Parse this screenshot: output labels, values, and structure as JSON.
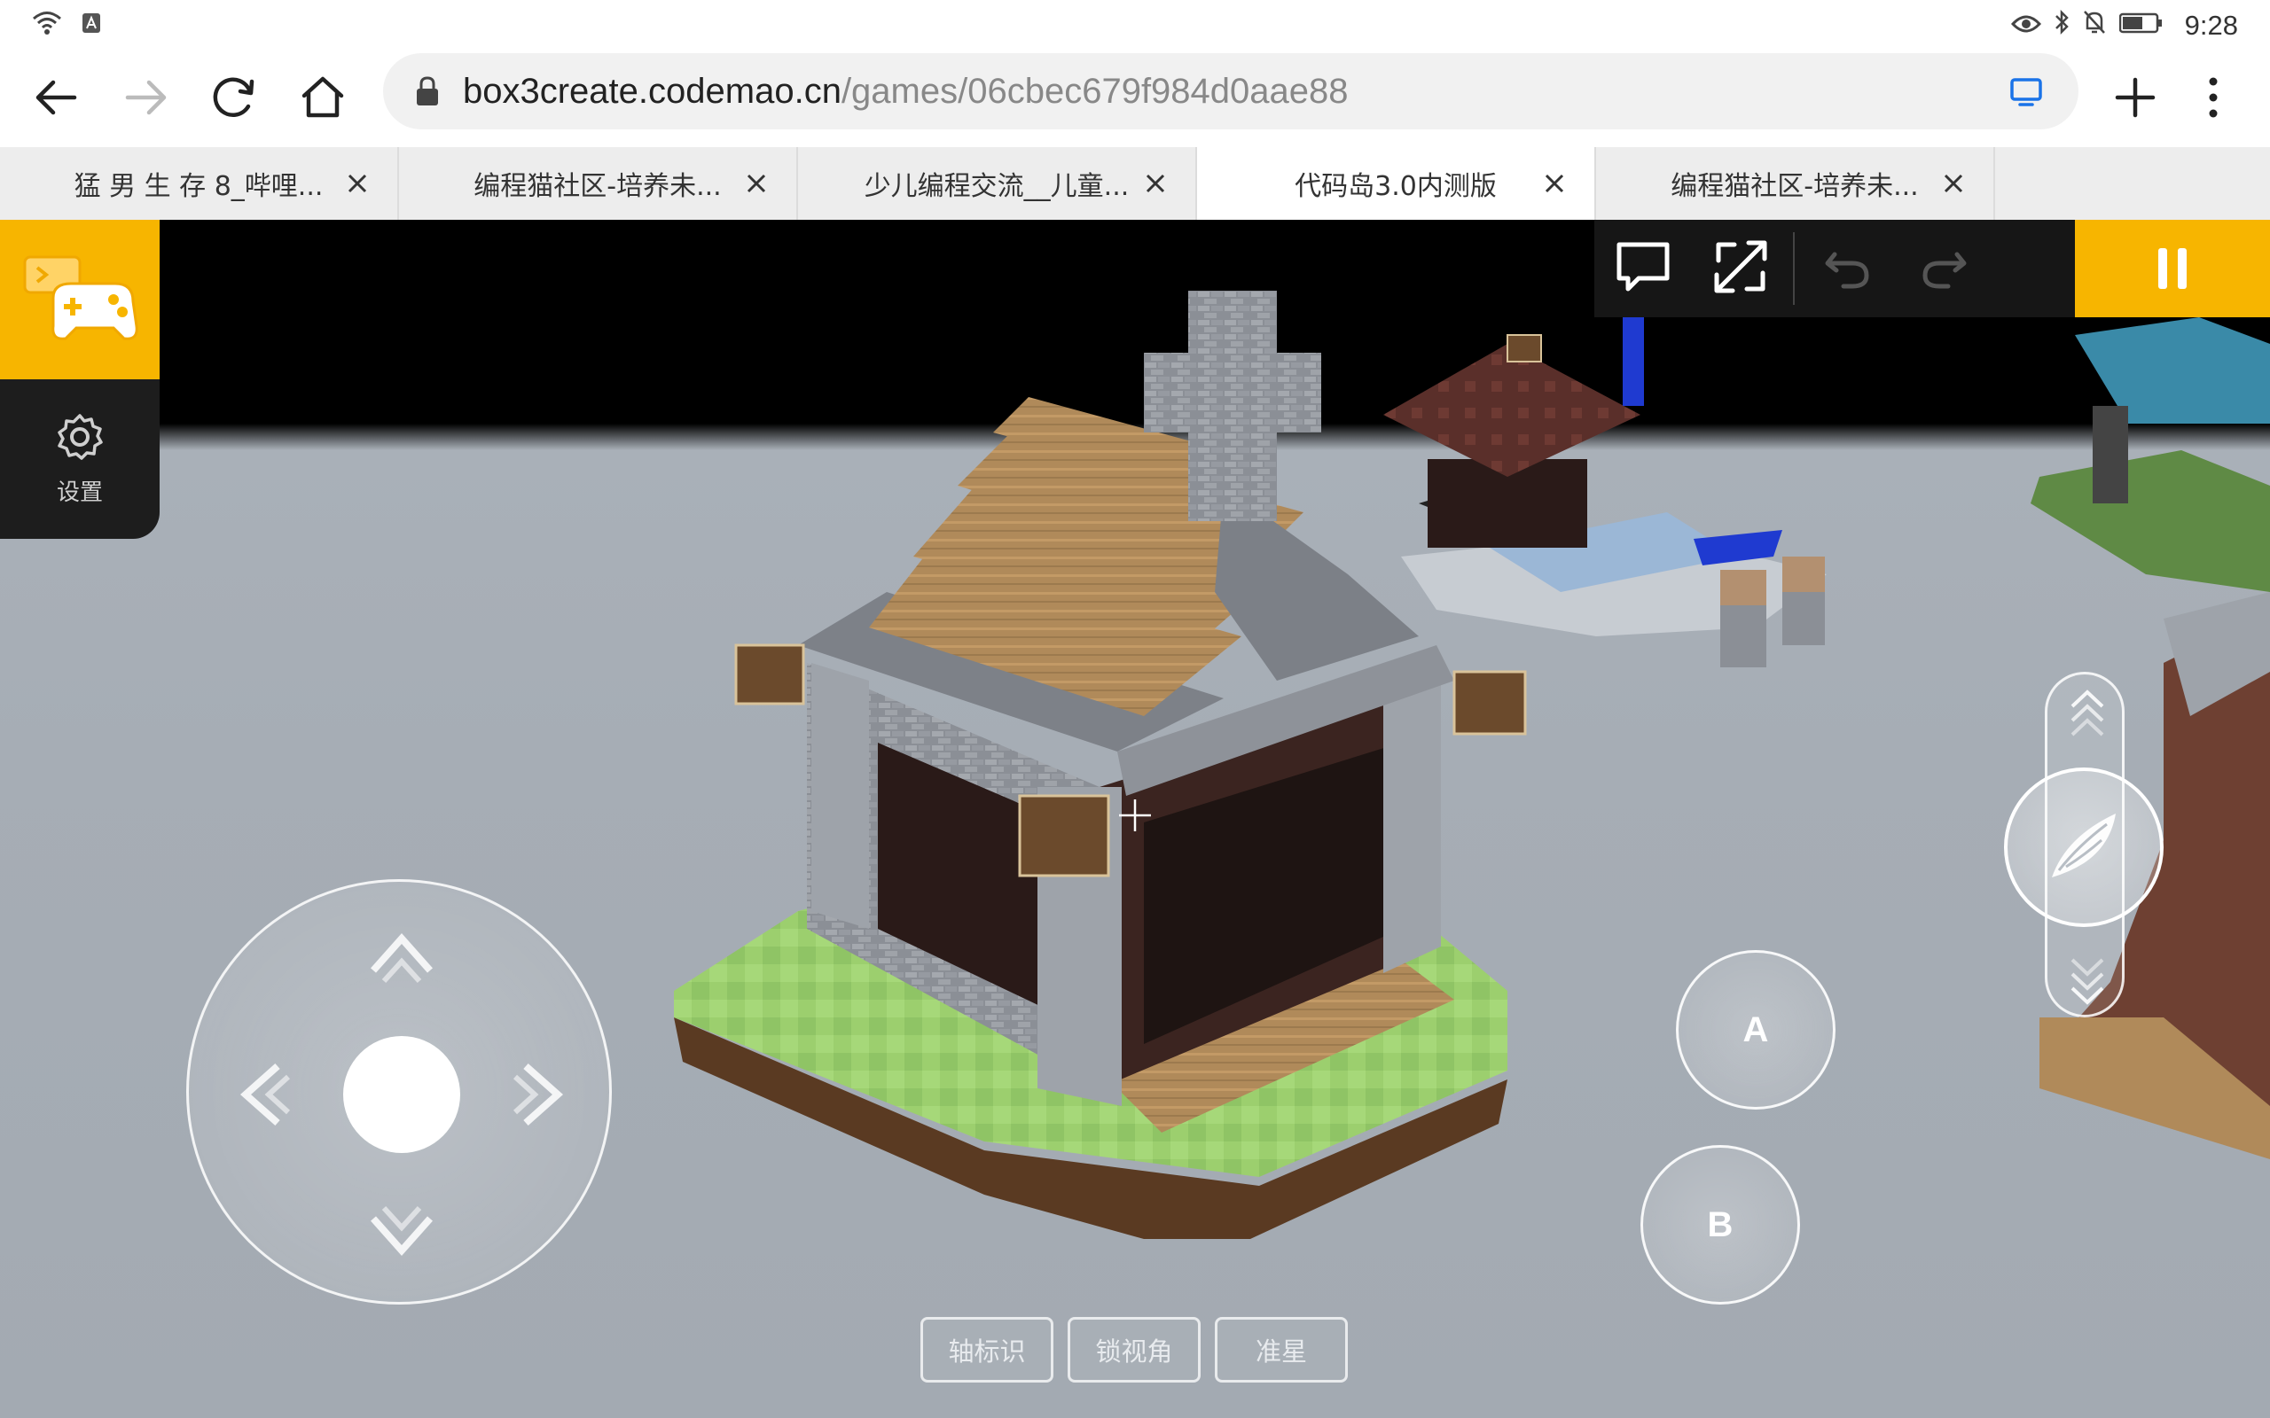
{
  "status_bar": {
    "time": "9:28"
  },
  "address_bar": {
    "url_host": "box3create.codemao.cn",
    "url_path": "/games/06cbec679f984d0aae88"
  },
  "tabs": [
    {
      "label": "猛 男 生 存 8_哔哩..."
    },
    {
      "label": "编程猫社区-培养未..."
    },
    {
      "label": "少儿编程交流__儿童..."
    },
    {
      "label": "代码岛3.0内测版",
      "active": true
    },
    {
      "label": "编程猫社区-培养未..."
    }
  ],
  "game": {
    "side_panel": {
      "settings_label": "设置"
    },
    "buttons": {
      "a_label": "A",
      "b_label": "B"
    },
    "options": [
      {
        "label": "轴标识"
      },
      {
        "label": "锁视角"
      },
      {
        "label": "准星"
      }
    ],
    "colors": {
      "accent": "#f7b500",
      "toolbar": "#161616",
      "sky": "#000000",
      "ground": "#a6adb5"
    }
  }
}
